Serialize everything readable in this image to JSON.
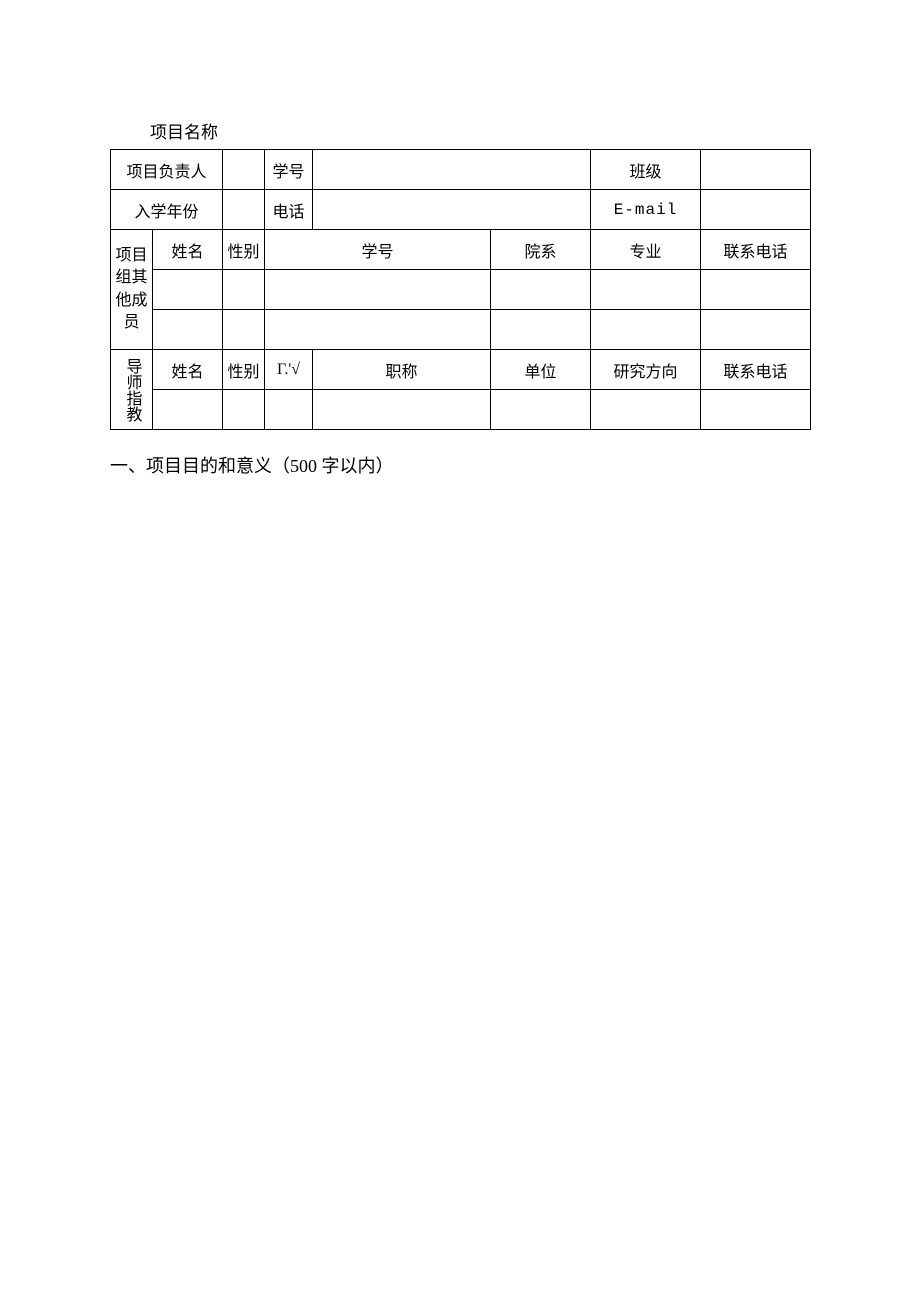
{
  "preTitle": "项目名称",
  "row1": {
    "leaderLabel": "项目负责人",
    "leaderValue": "",
    "idLabel": "学号",
    "idValue": "",
    "classLabel": "班级",
    "classValue": ""
  },
  "row2": {
    "enrollYearLabel": "入学年份",
    "enrollYearValue": "",
    "phoneLabel": "电话",
    "phoneValue": "",
    "emailLabel": "E-mail",
    "emailValue": ""
  },
  "members": {
    "groupLabel": "项目组其他成员",
    "headers": {
      "name": "姓名",
      "gender": "性别",
      "id": "学号",
      "dept": "院系",
      "major": "专业",
      "phone": "联系电话"
    },
    "rows": [
      {
        "name": "",
        "gender": "",
        "id": "",
        "dept": "",
        "major": "",
        "phone": ""
      },
      {
        "name": "",
        "gender": "",
        "id": "",
        "dept": "",
        "major": "",
        "phone": ""
      }
    ]
  },
  "advisor": {
    "groupLabel": "导师指教",
    "headers": {
      "name": "姓名",
      "gender": "性别",
      "col3": "Γ.'√",
      "title": "职称",
      "unit": "单位",
      "research": "研究方向",
      "phone": "联系电话"
    },
    "rows": [
      {
        "name": "",
        "gender": "",
        "col3": "",
        "title": "",
        "unit": "",
        "research": "",
        "phone": ""
      }
    ]
  },
  "sectionHeading": "一、项目目的和意义（500 字以内）"
}
